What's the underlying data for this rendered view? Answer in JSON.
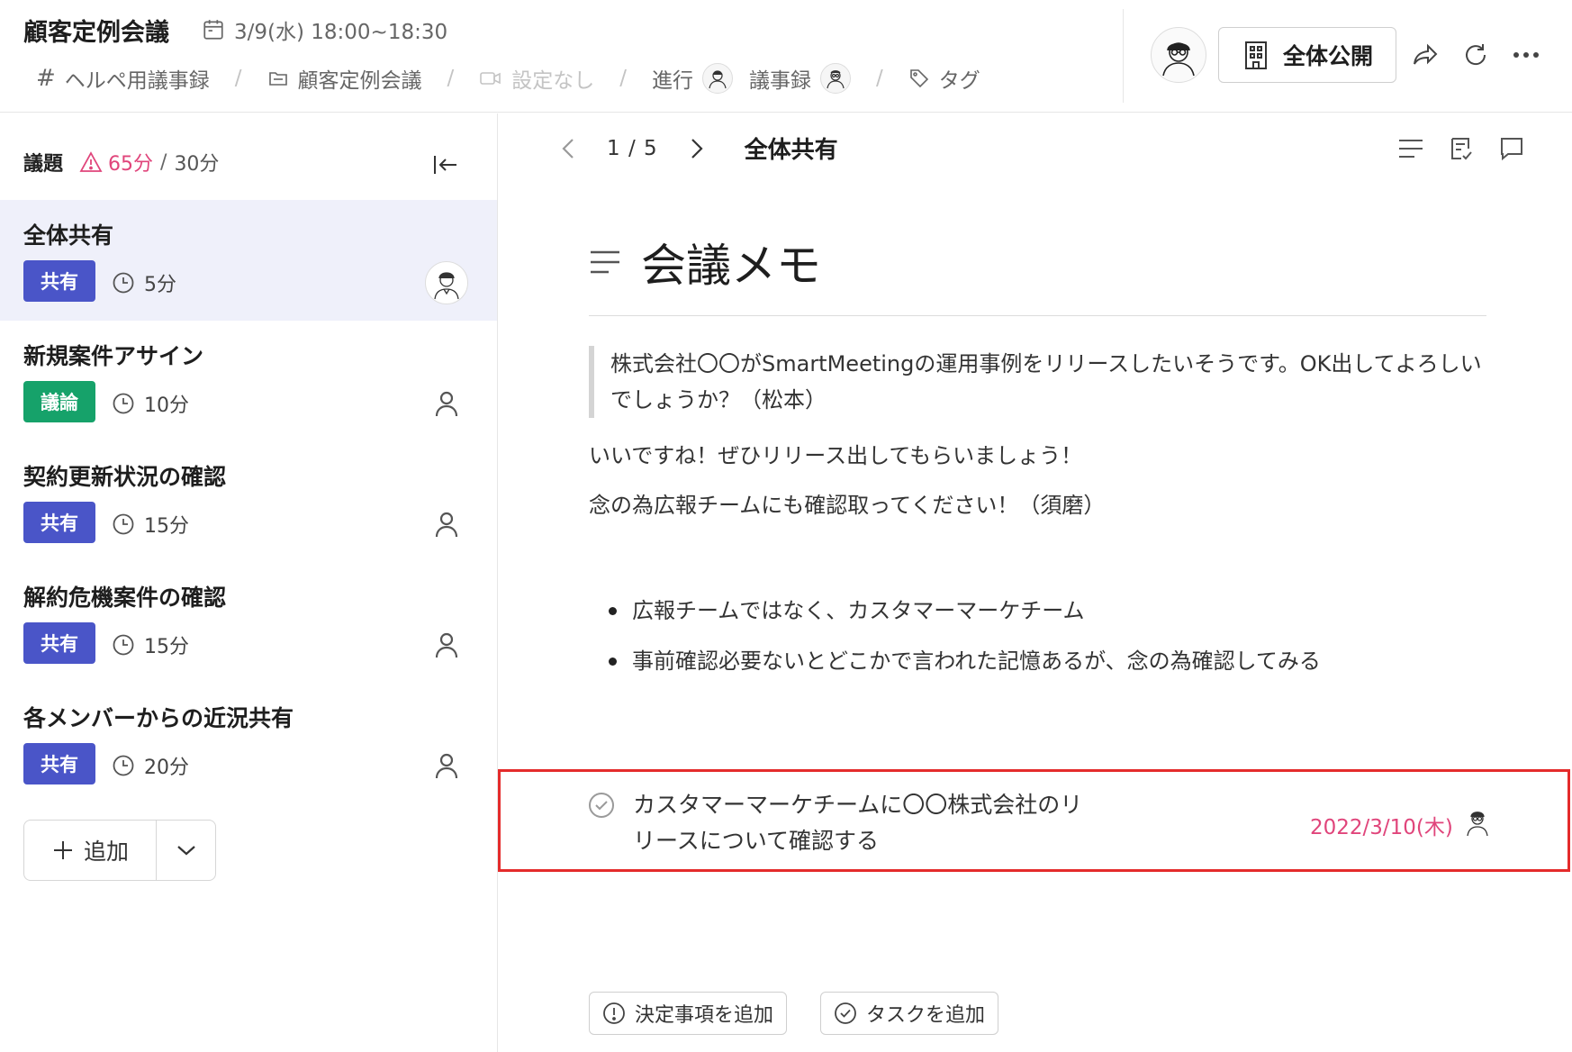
{
  "header": {
    "title": "顧客定例会議",
    "date_icon": "calendar-icon",
    "datetime": "3/9(水) 18:00~18:30",
    "breadcrumbs": [
      {
        "icon": "hash-icon",
        "label": "ヘルペ用議事録"
      },
      {
        "icon": "folder-icon",
        "label": "顧客定例会議"
      },
      {
        "icon": "video-icon",
        "label": "設定なし"
      },
      {
        "label": "進行"
      },
      {
        "label": "議事録"
      },
      {
        "icon": "tag-icon",
        "label": "タグ"
      }
    ],
    "visibility_label": "全体公開",
    "visibility_icon": "building-icon"
  },
  "sidebar": {
    "label": "議題",
    "over_time": "65分",
    "total_time": "30分",
    "items": [
      {
        "title": "全体共有",
        "badge": "共有",
        "badge_color": "#4a55c8",
        "duration": "5分",
        "owner": "photo",
        "active": true
      },
      {
        "title": "新規案件アサイン",
        "badge": "議論",
        "badge_color": "#16a26a",
        "duration": "10分",
        "owner": "person-icon",
        "active": false
      },
      {
        "title": "契約更新状況の確認",
        "badge": "共有",
        "badge_color": "#4a55c8",
        "duration": "15分",
        "owner": "person-icon",
        "active": false
      },
      {
        "title": "解約危機案件の確認",
        "badge": "共有",
        "badge_color": "#4a55c8",
        "duration": "15分",
        "owner": "person-icon",
        "active": false
      },
      {
        "title": "各メンバーからの近況共有",
        "badge": "共有",
        "badge_color": "#4a55c8",
        "duration": "20分",
        "owner": "person-icon",
        "active": false
      }
    ],
    "add_label": "追加"
  },
  "main": {
    "pager": {
      "current": "1",
      "total": "5",
      "text": "1 / 5"
    },
    "section_title": "全体共有",
    "memo_title": "会議メモ",
    "quote": "株式会社〇〇がSmartMeetingの運用事例をリリースしたいそうです。OK出してよろしいでしょうか？（松本）",
    "para1": "いいですね！ぜひリリース出してもらいましょう！",
    "para2": "念の為広報チームにも確認取ってください！（須磨）",
    "bullets": [
      "広報チームではなく、カスタマーマーケチーム",
      "事前確認必要ないとどこかで言われた記憶あるが、念の為確認してみる"
    ],
    "task": {
      "text": "カスタマーマーケチームに〇〇株式会社のリリースについて確認する",
      "due": "2022/3/10(木)"
    },
    "add_decision_label": "決定事項を追加",
    "add_task_label": "タスクを追加"
  },
  "colors": {
    "accent_pink": "#e0457b",
    "share_badge": "#4a55c8",
    "discuss_badge": "#16a26a",
    "highlight_red": "#e42b2b",
    "active_row": "#eff0fa"
  }
}
